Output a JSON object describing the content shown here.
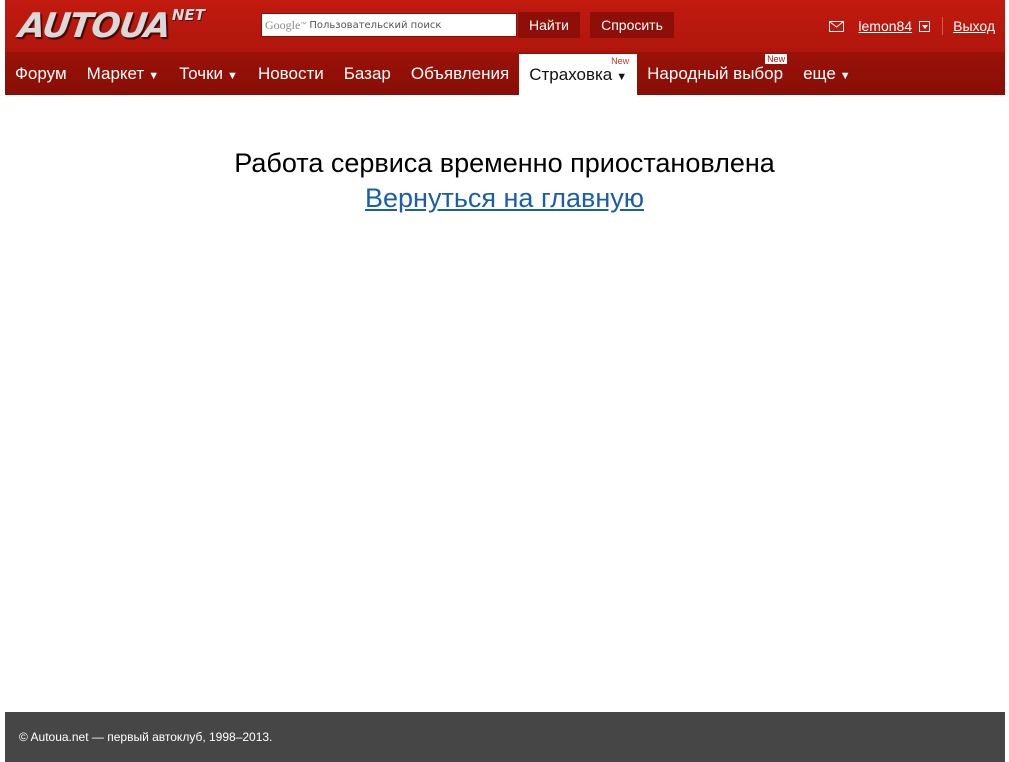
{
  "header": {
    "logo_main": "AUTOUA",
    "logo_sup": "NET",
    "search": {
      "brand": "Google",
      "placeholder": "Пользовательский поиск",
      "value": ""
    },
    "find_label": "Найти",
    "ask_label": "Спросить",
    "username": "lemon84",
    "logout_label": "Выход"
  },
  "nav": {
    "items": [
      {
        "label": "Форум"
      },
      {
        "label": "Маркет",
        "arrow": "▼"
      },
      {
        "label": "Точки",
        "arrow": "▼"
      },
      {
        "label": "Новости"
      },
      {
        "label": "Базар"
      },
      {
        "label": "Объявления"
      },
      {
        "label": "Страховка",
        "arrow": "▼",
        "badge": "New",
        "active": true
      },
      {
        "label": "Народный выбор",
        "badge": "New"
      },
      {
        "label": "еще",
        "arrow": "▼"
      }
    ]
  },
  "main": {
    "message": "Работа сервиса временно приостановлена",
    "home_link": "Вернуться на главную"
  },
  "footer": {
    "copyright": "© Autoua.net — первый автоклуб, 1998–2013."
  },
  "colors": {
    "topbar": "#b0160c",
    "navbar": "#8e0f08",
    "button": "#8e0f08",
    "link": "#1a5ea8",
    "footer": "#464646"
  }
}
